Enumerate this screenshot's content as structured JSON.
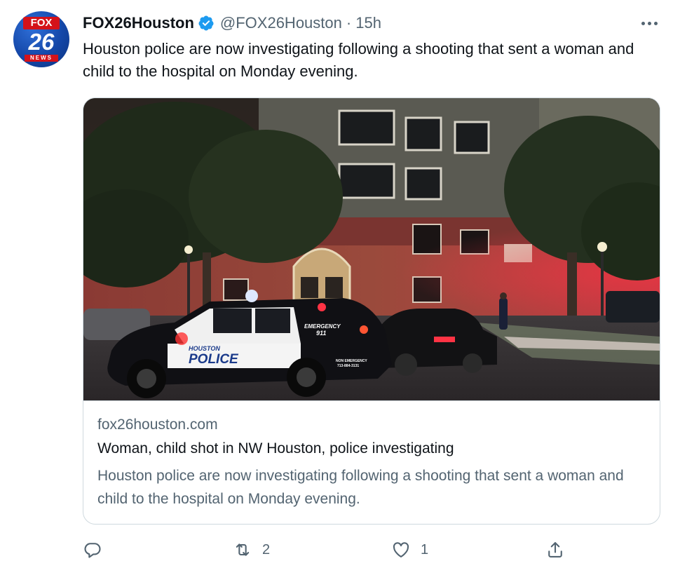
{
  "tweet": {
    "display_name": "FOX26Houston",
    "handle": "@FOX26Houston",
    "separator": "·",
    "time": "15h",
    "text": "Houston police are now investigating following a shooting that sent a woman and child to the hospital on Monday evening.",
    "avatar": {
      "top": "FOX",
      "number": "26",
      "bottom": "NEWS"
    }
  },
  "card": {
    "domain": "fox26houston.com",
    "title": "Woman, child shot in NW Houston, police investigating",
    "description": "Houston police are now investigating following a shooting that sent a woman and child to the hospital on Monday evening.",
    "image_text": {
      "car_brand_small": "HOUSTON",
      "car_brand": "POLICE",
      "emergency": "EMERGENCY",
      "emergency_number": "911",
      "non_emergency": "NON EMERGENCY",
      "non_emergency_number": "713-884-3131"
    }
  },
  "actions": {
    "reply_count": "",
    "retweet_count": "2",
    "like_count": "1"
  },
  "colors": {
    "accent": "#1d9bf0",
    "secondary_text": "#536471",
    "border": "#cfd9de"
  },
  "icons": [
    "verified-badge-icon",
    "more-options-icon",
    "reply-icon",
    "retweet-icon",
    "like-icon",
    "share-icon"
  ]
}
